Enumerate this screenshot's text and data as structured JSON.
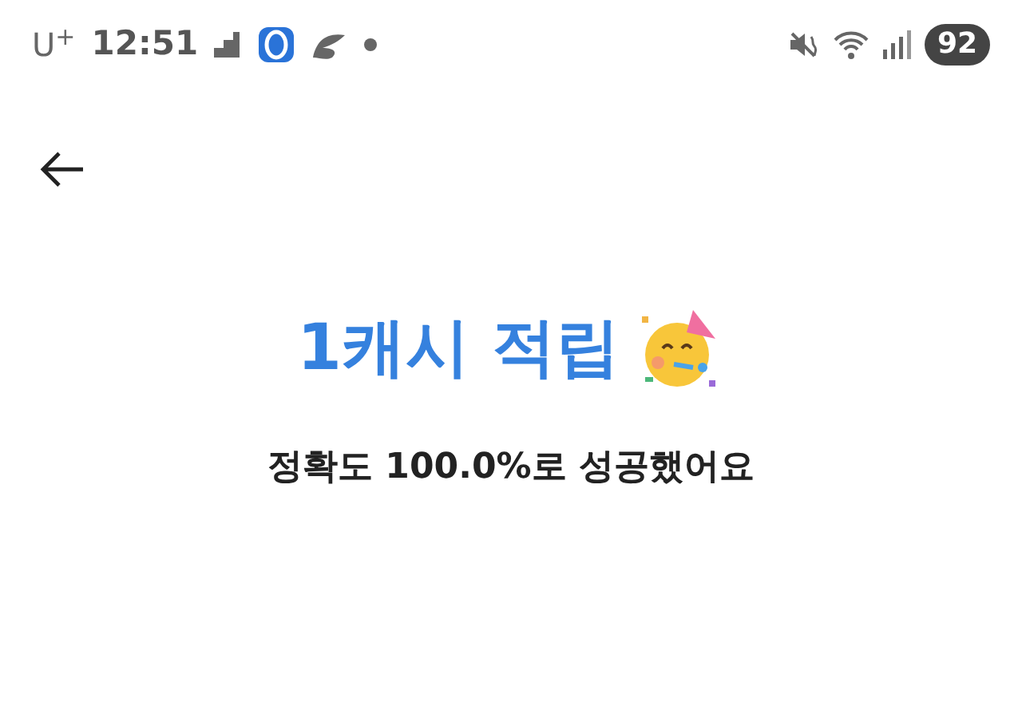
{
  "status_bar": {
    "carrier": "U$^{+}$",
    "time": "12:51",
    "battery": "92"
  },
  "title": "1캐시 적립",
  "message": "정확도 100.0%로 성공했어요"
}
